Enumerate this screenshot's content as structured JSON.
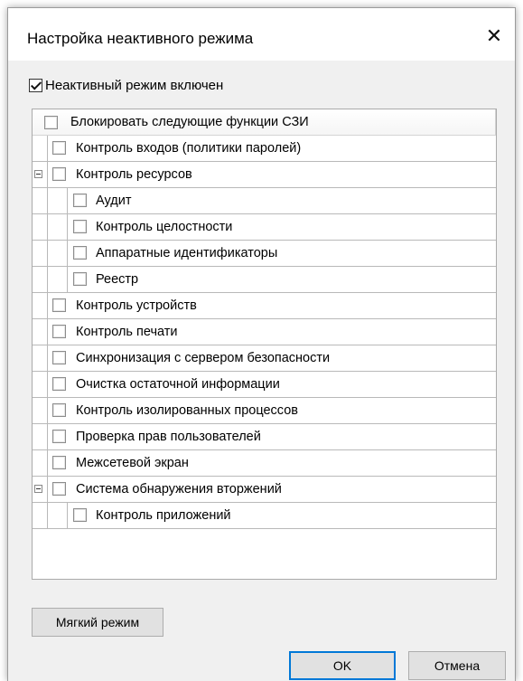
{
  "window": {
    "title": "Настройка неактивного режима",
    "close_glyph": "✕"
  },
  "enabled_checkbox": {
    "label": "Неактивный режим включен",
    "checked": true
  },
  "tree": {
    "header": {
      "label": "Блокировать следующие функции СЗИ",
      "checked": false
    },
    "items": [
      {
        "label": "Контроль входов (политики паролей)",
        "level": 0,
        "checked": false,
        "expander": false
      },
      {
        "label": "Контроль ресурсов",
        "level": 0,
        "checked": false,
        "expander": true
      },
      {
        "label": "Аудит",
        "level": 1,
        "checked": false,
        "expander": false
      },
      {
        "label": "Контроль целостности",
        "level": 1,
        "checked": false,
        "expander": false
      },
      {
        "label": "Аппаратные идентификаторы",
        "level": 1,
        "checked": false,
        "expander": false
      },
      {
        "label": "Реестр",
        "level": 1,
        "checked": false,
        "expander": false
      },
      {
        "label": "Контроль устройств",
        "level": 0,
        "checked": false,
        "expander": false
      },
      {
        "label": "Контроль печати",
        "level": 0,
        "checked": false,
        "expander": false
      },
      {
        "label": "Синхронизация с сервером безопасности",
        "level": 0,
        "checked": false,
        "expander": false
      },
      {
        "label": "Очистка остаточной информации",
        "level": 0,
        "checked": false,
        "expander": false
      },
      {
        "label": "Контроль изолированных процессов",
        "level": 0,
        "checked": false,
        "expander": false
      },
      {
        "label": "Проверка прав пользователей",
        "level": 0,
        "checked": false,
        "expander": false
      },
      {
        "label": "Межсетевой экран",
        "level": 0,
        "checked": false,
        "expander": false
      },
      {
        "label": "Система обнаружения вторжений",
        "level": 0,
        "checked": false,
        "expander": true
      },
      {
        "label": "Контроль приложений",
        "level": 1,
        "checked": false,
        "expander": false
      }
    ]
  },
  "buttons": {
    "soft_mode": "Мягкий режим",
    "ok": "OK",
    "cancel": "Отмена"
  },
  "colors": {
    "dialog_bg": "#f0f0f0",
    "accent": "#0078d7",
    "grid_line": "#b9b9b9"
  }
}
